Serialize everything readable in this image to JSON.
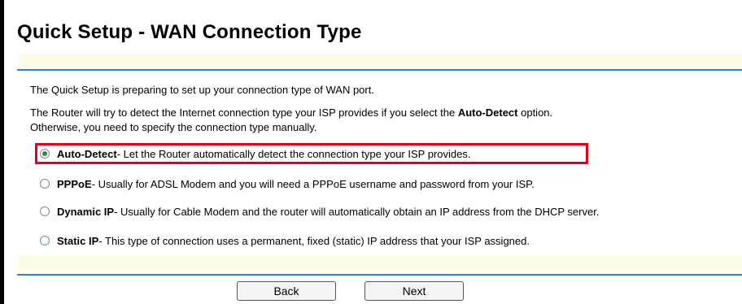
{
  "page": {
    "title": "Quick Setup - WAN Connection Type"
  },
  "intro": {
    "line1": "The Quick Setup is preparing to set up your connection type of WAN port.",
    "line2_before": "The Router will try to detect the Internet connection type your ISP provides if you select the ",
    "line2_bold": "Auto-Detect",
    "line2_after": " option.",
    "line3": "Otherwise, you need to specify the connection type manually."
  },
  "options": [
    {
      "name": "Auto-Detect",
      "description": " - Let the Router automatically detect the connection type your ISP provides.",
      "selected": true
    },
    {
      "name": "PPPoE",
      "description": " - Usually for ADSL Modem and you will need a PPPoE username and password from your ISP.",
      "selected": false
    },
    {
      "name": "Dynamic IP",
      "description": " - Usually for Cable Modem and the router will automatically obtain an IP address from the DHCP server.",
      "selected": false
    },
    {
      "name": "Static IP",
      "description": " - This type of connection uses a permanent, fixed (static) IP address that your ISP assigned.",
      "selected": false
    }
  ],
  "buttons": {
    "back": "Back",
    "next": "Next"
  },
  "colors": {
    "rule": "#2a86c8",
    "band": "#fcfce8",
    "highlight": "#e0001b",
    "radio_dot": "#2e8b3e"
  }
}
